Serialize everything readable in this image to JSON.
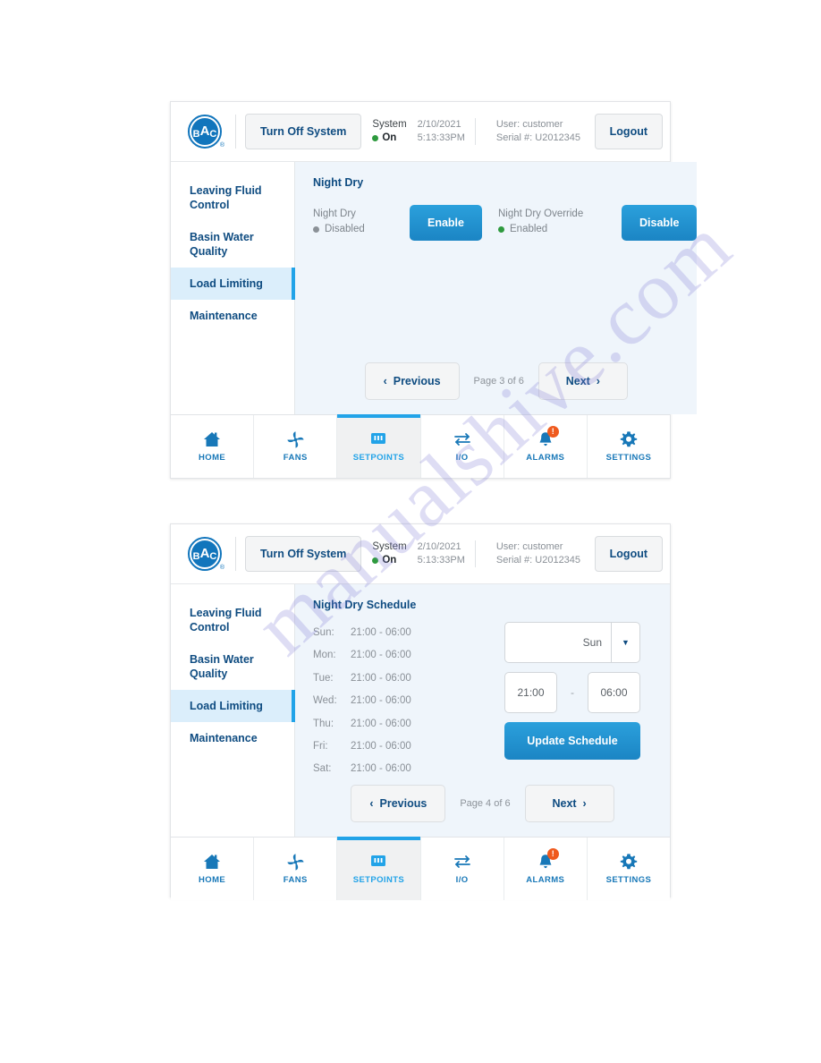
{
  "watermark": {
    "text": "manualshive.com"
  },
  "header": {
    "logo_text": "BAC",
    "logo_main": "A",
    "logo_b": "B",
    "logo_c": "C",
    "turn_off_label": "Turn Off System",
    "system_label": "System",
    "system_state": "On",
    "date": "2/10/2021",
    "time": "5:13:33PM",
    "user": "User: customer",
    "serial": "Serial #: U2012345",
    "logout_label": "Logout"
  },
  "sidebar": {
    "items": [
      {
        "label": "Leaving Fluid Control",
        "active": false
      },
      {
        "label": "Basin Water Quality",
        "active": false
      },
      {
        "label": "Load Limiting",
        "active": true
      },
      {
        "label": "Maintenance",
        "active": false
      }
    ]
  },
  "panel1": {
    "title": "Night Dry",
    "night_dry": {
      "label": "Night Dry",
      "state": "Disabled",
      "state_color": "#8b9197",
      "button": "Enable"
    },
    "night_dry_override": {
      "label": "Night Dry Override",
      "state": "Enabled",
      "state_color": "#2e9a3e",
      "button": "Disable"
    },
    "pager": {
      "previous": "Previous",
      "page_label": "Page 3 of 6",
      "next": "Next"
    }
  },
  "panel2": {
    "title": "Night Dry Schedule",
    "schedule": [
      {
        "day": "Sun:",
        "time": "21:00 - 06:00"
      },
      {
        "day": "Mon:",
        "time": "21:00 - 06:00"
      },
      {
        "day": "Tue:",
        "time": "21:00 - 06:00"
      },
      {
        "day": "Wed:",
        "time": "21:00 - 06:00"
      },
      {
        "day": "Thu:",
        "time": "21:00 - 06:00"
      },
      {
        "day": "Fri:",
        "time": "21:00 - 06:00"
      },
      {
        "day": "Sat:",
        "time": "21:00 - 06:00"
      }
    ],
    "form": {
      "day_selected": "Sun",
      "start_time": "21:00",
      "dash": "-",
      "end_time": "06:00",
      "update_label": "Update Schedule"
    },
    "pager": {
      "previous": "Previous",
      "page_label": "Page 4 of 6",
      "next": "Next"
    }
  },
  "bottomnav": {
    "items": [
      {
        "label": "HOME",
        "icon": "home-icon",
        "active": false,
        "badge": ""
      },
      {
        "label": "FANS",
        "icon": "fan-icon",
        "active": false,
        "badge": ""
      },
      {
        "label": "SETPOINTS",
        "icon": "setpoints-icon",
        "active": true,
        "badge": ""
      },
      {
        "label": "I/O",
        "icon": "io-arrows-icon",
        "active": false,
        "badge": ""
      },
      {
        "label": "ALARMS",
        "icon": "bell-icon",
        "active": false,
        "badge": "!"
      },
      {
        "label": "SETTINGS",
        "icon": "gear-icon",
        "active": false,
        "badge": ""
      }
    ]
  },
  "colors": {
    "accent_blue": "#22a3e8",
    "deep_blue": "#0f4c81",
    "brand_blue": "#1175bc",
    "status_green": "#2e9a3e",
    "status_gray": "#8b9197",
    "badge_orange": "#ef5a1e",
    "content_bg": "#eff5fb"
  }
}
